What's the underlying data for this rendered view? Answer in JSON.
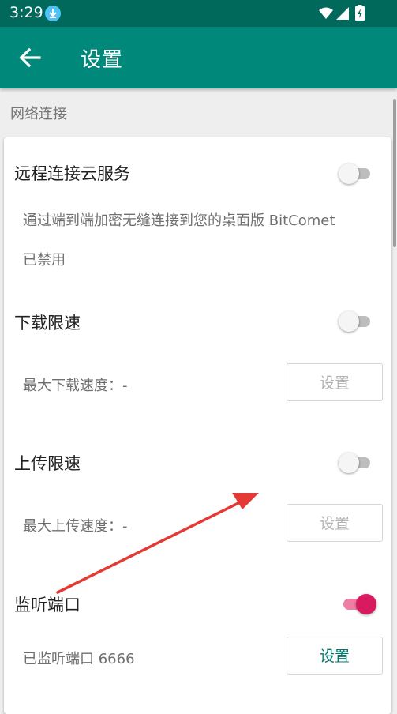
{
  "status_bar": {
    "time": "3:29",
    "icons": [
      "download-icon",
      "wifi-icon",
      "signal-icon",
      "battery-icon"
    ]
  },
  "app_bar": {
    "title": "设置",
    "back_icon": "arrow-back-icon"
  },
  "section": {
    "header": "网络连接"
  },
  "items": [
    {
      "title": "远程连接云服务",
      "description": "通过端到端加密无缝连接到您的桌面版 BitComet",
      "status": "已禁用",
      "switch_on": false
    },
    {
      "title": "下载限速",
      "description": "最大下载速度：-",
      "button_label": "设置",
      "button_enabled": false,
      "switch_on": false
    },
    {
      "title": "上传限速",
      "description": "最大上传速度：-",
      "button_label": "设置",
      "button_enabled": false,
      "switch_on": false
    },
    {
      "title": "监听端口",
      "description": "已监听端口 6666",
      "button_label": "设置",
      "button_enabled": true,
      "switch_on": true
    }
  ],
  "colors": {
    "status_bar": "#00695c",
    "app_bar": "#00897b",
    "accent": "#d81b60",
    "annotation_arrow": "#e53935"
  }
}
